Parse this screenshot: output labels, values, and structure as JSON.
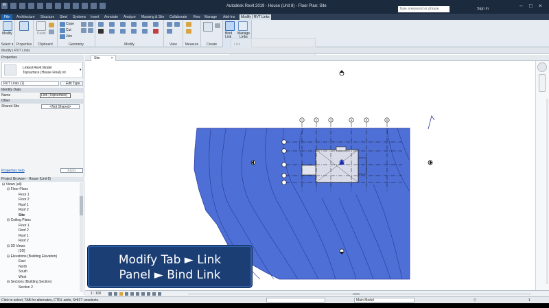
{
  "window": {
    "title": "Autodesk Revit 2019 - House (Unit 8) - Floor Plan: Site",
    "search_placeholder": "Type a keyword or phrase",
    "sign_in": "Sign In"
  },
  "ribbon_tabs": [
    "File",
    "Architecture",
    "Structure",
    "Steel",
    "Systems",
    "Insert",
    "Annotate",
    "Analyze",
    "Massing & Site",
    "Collaborate",
    "View",
    "Manage",
    "Add-Ins",
    "Modify | RVT Links"
  ],
  "ribbon": {
    "select_label": "Select ▾",
    "modify_label": "Modify",
    "groups": [
      "Properties",
      "Clipboard",
      "Geometry",
      "Modify",
      "View",
      "Measure",
      "Create",
      "Link"
    ],
    "clipboard": {
      "paste": "Paste",
      "cut": "Cut",
      "copy": "Cope",
      "join": "Join"
    },
    "link_buttons": {
      "bind": "Bind Link",
      "manage": "Manage Links"
    }
  },
  "context_bar": "Modify | RVT Links",
  "properties": {
    "header": "Properties",
    "type_line1": "Linked Revit Model",
    "type_line2": "Topsurface (House Final).rvt",
    "selector": "RVT Links (1)",
    "edit_type": "Edit Type",
    "sections": {
      "identity": "Identity Data",
      "other": "Other"
    },
    "rows": {
      "name_label": "Name",
      "name_value": "Link (Topsurface)",
      "shared_label": "Shared Site",
      "shared_value": "<Not Shared>"
    },
    "help": "Properties help",
    "apply": "Apply"
  },
  "browser": {
    "header": "Project Browser - House (Unit 8)",
    "items": [
      "Views (all)",
      "Floor Plans",
      "Floor 1",
      "Floor 2",
      "Roof 1",
      "Roof 2",
      "Site",
      "Ceiling Plans",
      "Floor 1",
      "Roof 2",
      "Roof 1",
      "Roof 2",
      "3D Views",
      "{3D}",
      "Elevations (Building Elevation)",
      "East",
      "North",
      "South",
      "West",
      "Sections (Building Section)",
      "Section 2"
    ]
  },
  "view": {
    "tab": "Site",
    "scale": "1 : 100",
    "model_selector": "Main Model"
  },
  "status": {
    "message": "Click to select, TAB for alternates, CTRL adds, SHIFT unselects.",
    "count": "1"
  },
  "caption": {
    "line1": "Modify Tab ► Link",
    "line2": "Panel ► Bind Link"
  },
  "grid_bubbles": [
    "1",
    "2",
    "3",
    "4",
    "5",
    "6"
  ],
  "colors": {
    "topo_fill": "#4d6fd6",
    "title_bar": "#1c2a3d",
    "caption_bg": "#1b3e75",
    "file_tab": "#1a63b3"
  }
}
